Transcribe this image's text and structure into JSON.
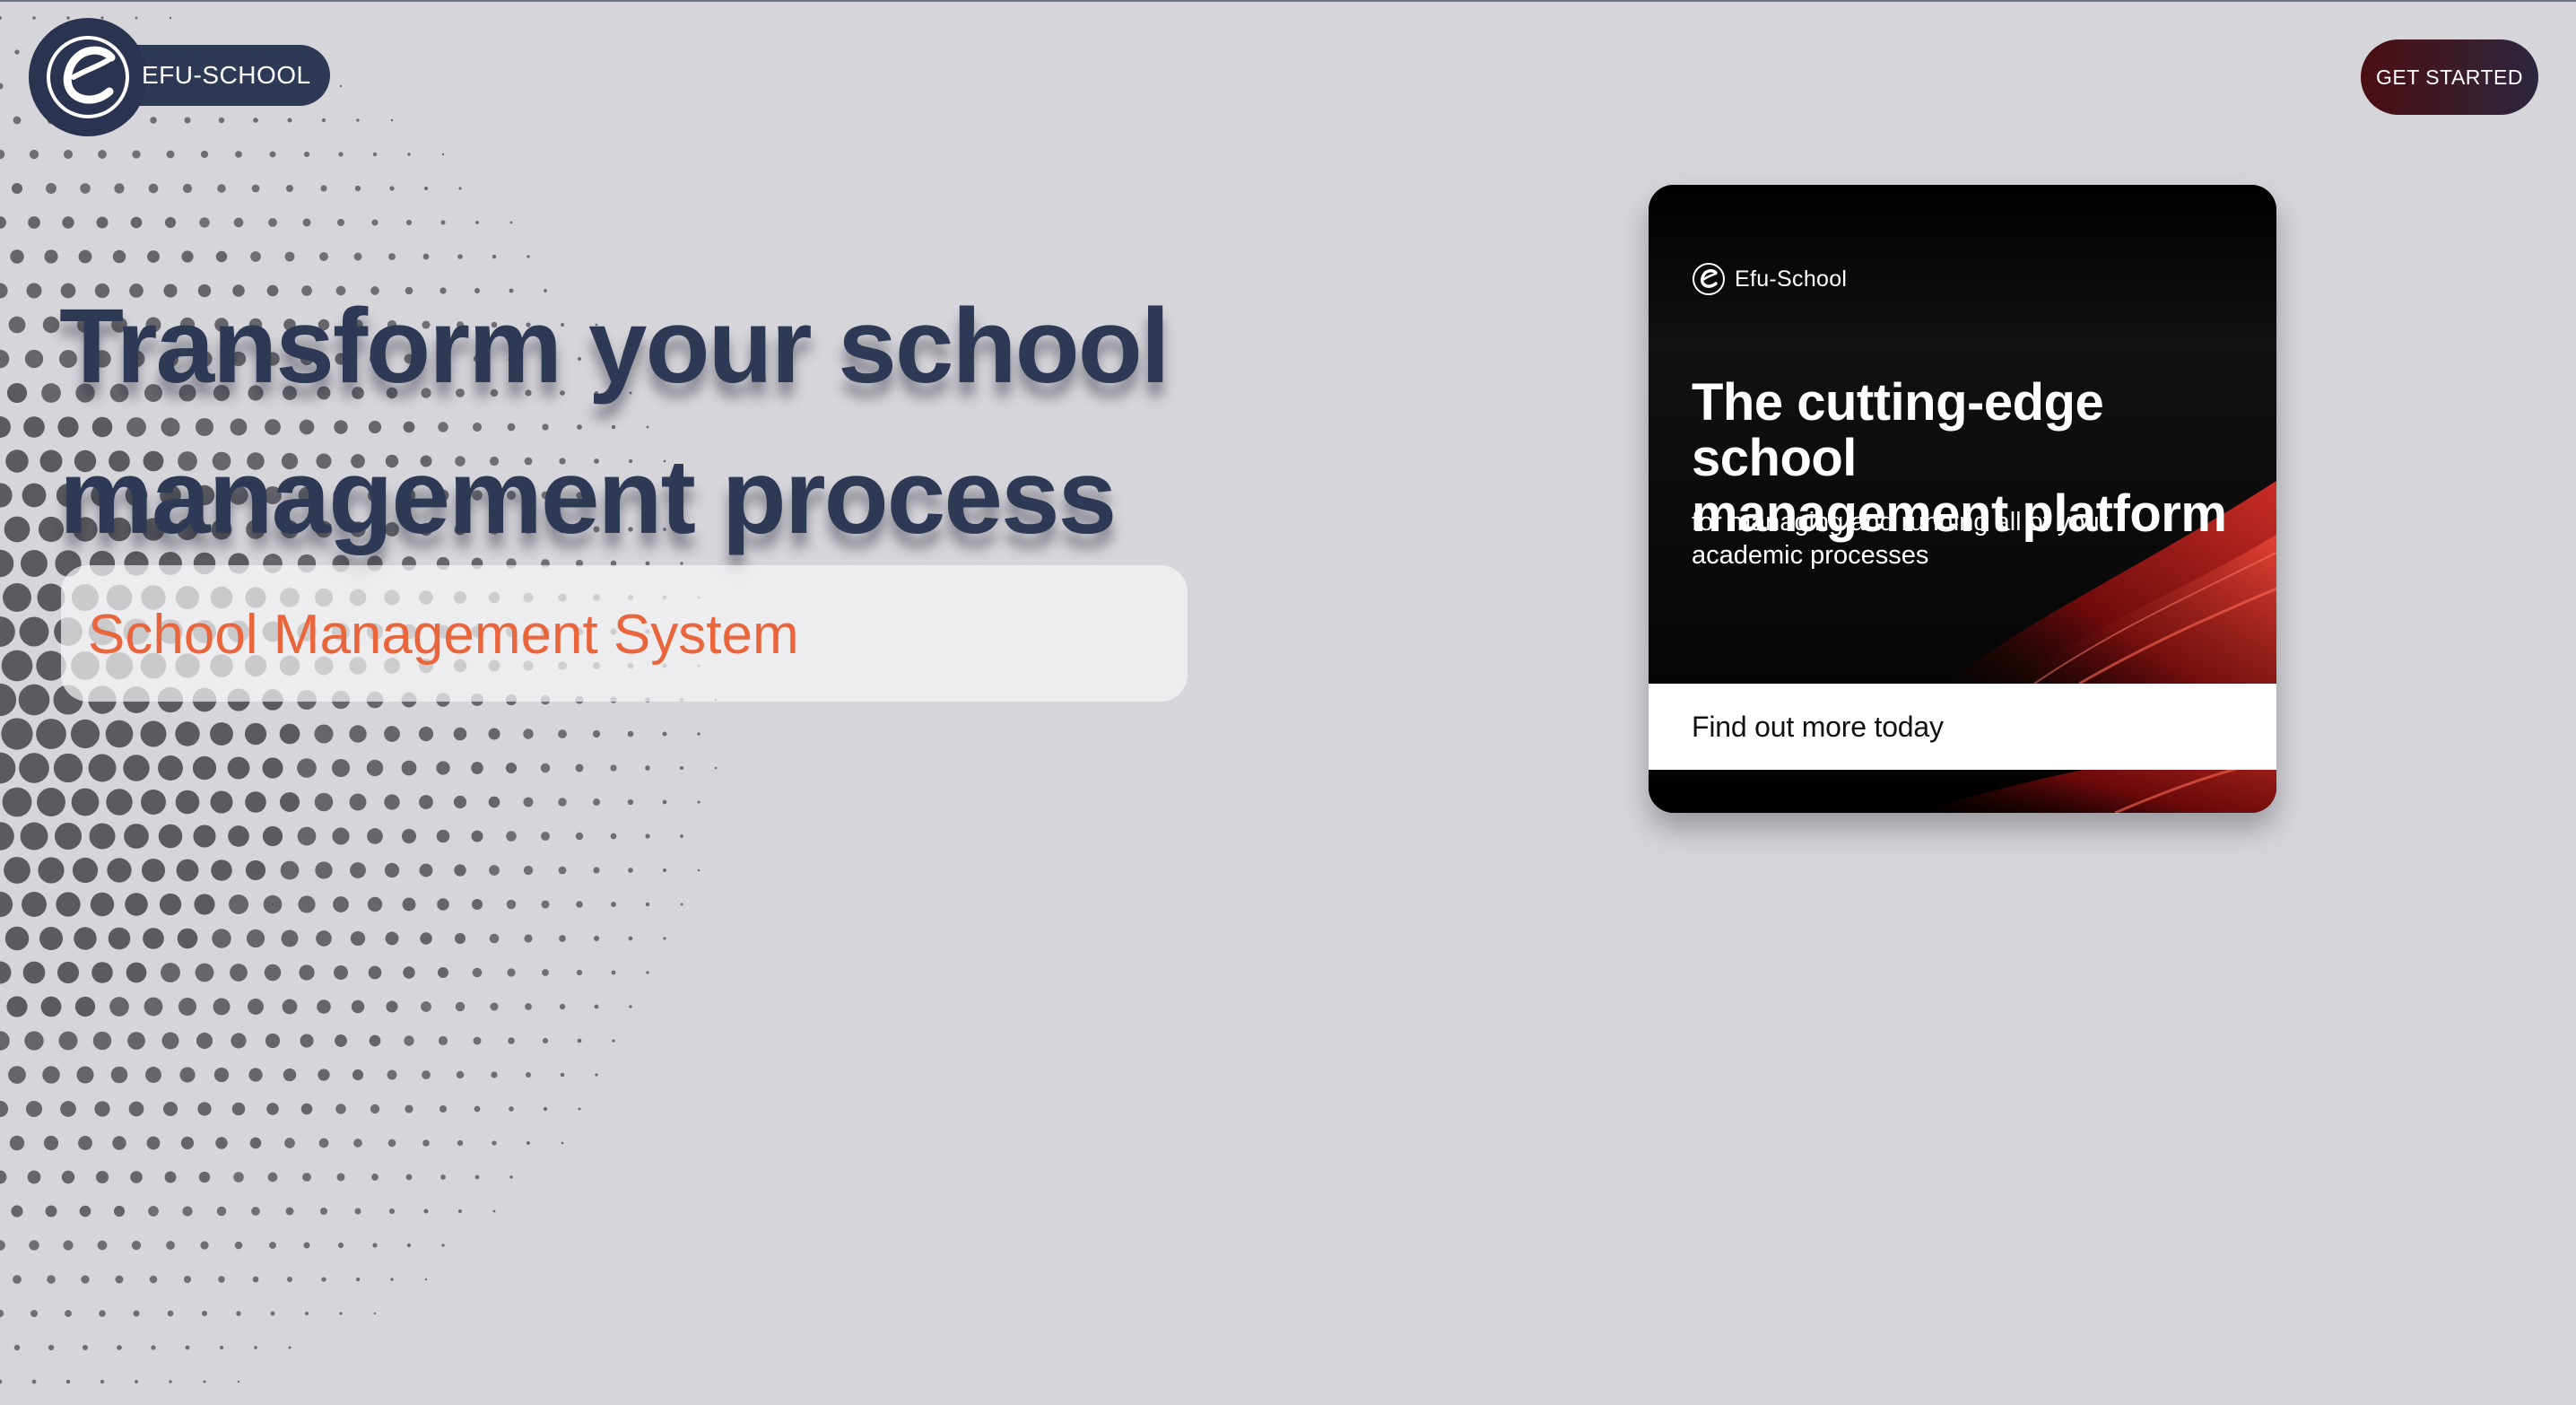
{
  "header": {
    "brand_name": "EFU-SCHOOL",
    "cta_label": "GET STARTED"
  },
  "hero": {
    "title_line1": "Transform your school",
    "title_line2": "management process",
    "subtitle": "School Management System"
  },
  "promo_card": {
    "brand": "Efu-School",
    "headline_line1": "The cutting-edge school",
    "headline_line2": "management platform",
    "sub_line1": "for managing and running all of your",
    "sub_line2": "academic processes",
    "cta": "Find out more today"
  },
  "colors": {
    "background": "#d6d5da",
    "navy": "#2e3a55",
    "accent_orange": "#e9663c",
    "cta_red": "#4b0d14"
  },
  "icons": [
    "efu-logo-icon",
    "halftone-dots-decoration"
  ]
}
